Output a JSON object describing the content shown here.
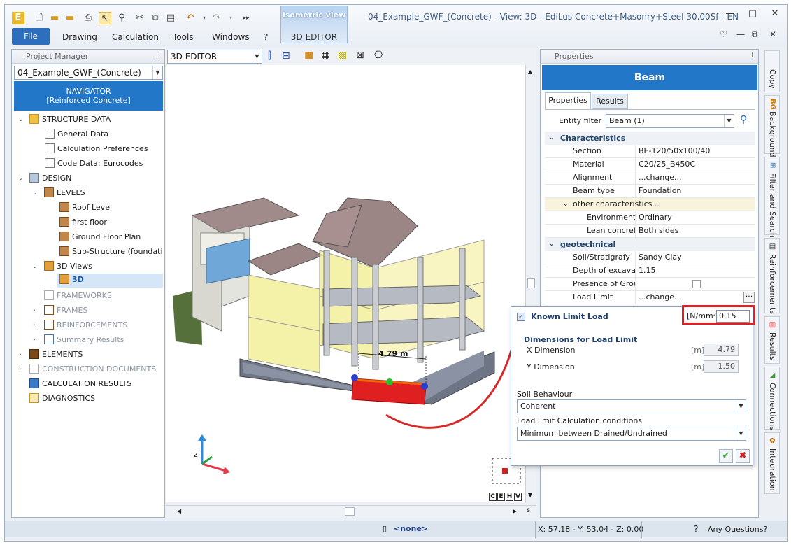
{
  "window": {
    "title": "04_Example_GWF_(Concrete) -  View: 3D - EdiLus Concrete+Masonry+Steel 30.00Sf - EN",
    "contextual_tab": {
      "group": "Isometric view",
      "tab": "3D EDITOR"
    }
  },
  "ribbon": {
    "file_label": "File",
    "tabs": [
      "Drawing",
      "Calculation",
      "Tools",
      "Windows",
      "?"
    ]
  },
  "project_manager": {
    "title": "Project Manager",
    "project_combo": "04_Example_GWF_(Concrete)",
    "navigator_line1": "NAVIGATOR",
    "navigator_line2": "[Reinforced Concrete]",
    "tree": {
      "structure_data": "STRUCTURE DATA",
      "general_data": "General Data",
      "calc_prefs": "Calculation Preferences",
      "code_data": "Code Data: Eurocodes",
      "design": "DESIGN",
      "levels": "LEVELS",
      "roof_level": "Roof Level",
      "first_floor": "first floor",
      "ground_floor": "Ground Floor Plan",
      "sub_structure": "Sub-Structure (foundations)",
      "views_3d": "3D Views",
      "view_3d": "3D",
      "frameworks": "FRAMEWORKS",
      "frames": "FRAMES",
      "reinforcements": "REINFORCEMENTS",
      "summary_results": "Summary Results",
      "elements": "ELEMENTS",
      "construction_docs": "CONSTRUCTION DOCUMENTS",
      "calc_results": "CALCULATION RESULTS",
      "diagnostics": "DIAGNOSTICS"
    }
  },
  "viewport": {
    "combo": "3D EDITOR",
    "dimension_label": "4.79 m",
    "axis_z": "z",
    "view_cube_letters": [
      "C",
      "E",
      "H",
      "V"
    ]
  },
  "properties": {
    "title": "Properties",
    "object_title": "Beam",
    "tabs": [
      "Properties",
      "Results"
    ],
    "entity_filter_label": "Entity filter",
    "entity_filter_value": "Beam (1)",
    "sections": {
      "characteristics": "Characteristics",
      "other": "other characteristics...",
      "geotechnical": "geotechnical"
    },
    "rows": {
      "section": {
        "label": "Section",
        "value": "BE-120/50x100/40"
      },
      "material": {
        "label": "Material",
        "value": "C20/25_B450C"
      },
      "alignment": {
        "label": "Alignment",
        "value": "...change..."
      },
      "beam_type": {
        "label": "Beam type",
        "value": "Foundation"
      },
      "environmental": {
        "label": "Environmental",
        "value": "Ordinary"
      },
      "lean_concrete": {
        "label": "Lean concrete",
        "value": "Both sides"
      },
      "soil": {
        "label": "Soil/Stratigrafy",
        "value": "Sandy Clay"
      },
      "depth": {
        "label": "Depth of excavation",
        "value": "1.15"
      },
      "presence": {
        "label": "Presence of Groundwater",
        "value": ""
      },
      "load_limit": {
        "label": "Load Limit",
        "value": "...change..."
      }
    }
  },
  "load_limit_popup": {
    "known_label": "Known Limit Load",
    "unit": "[N/mm²]",
    "value": "0.15",
    "dimensions_title": "Dimensions for Load Limit",
    "x_label": "X Dimension",
    "x_unit": "[m]",
    "x_value": "4.79",
    "y_label": "Y Dimension",
    "y_unit": "[m]",
    "y_value": "1.50",
    "soil_behaviour_label": "Soil Behaviour",
    "soil_behaviour_value": "Coherent",
    "conditions_label": "Load limit Calculation conditions",
    "conditions_value": "Minimum between Drained/Undrained"
  },
  "side_tabs": [
    "Copy",
    "Background",
    "Filter and Search",
    "Reinforcements",
    "Results",
    "Connections",
    "Integration"
  ],
  "statusbar": {
    "layer": "<none>",
    "coords": "X: 57.18 - Y: 53.04 - Z: 0.00",
    "help": "Any Questions?"
  },
  "colors": {
    "accent": "#2277c9",
    "highlight_red": "#e02020",
    "glass_yellow": "#f3ef9a",
    "roof": "#9b8585"
  }
}
